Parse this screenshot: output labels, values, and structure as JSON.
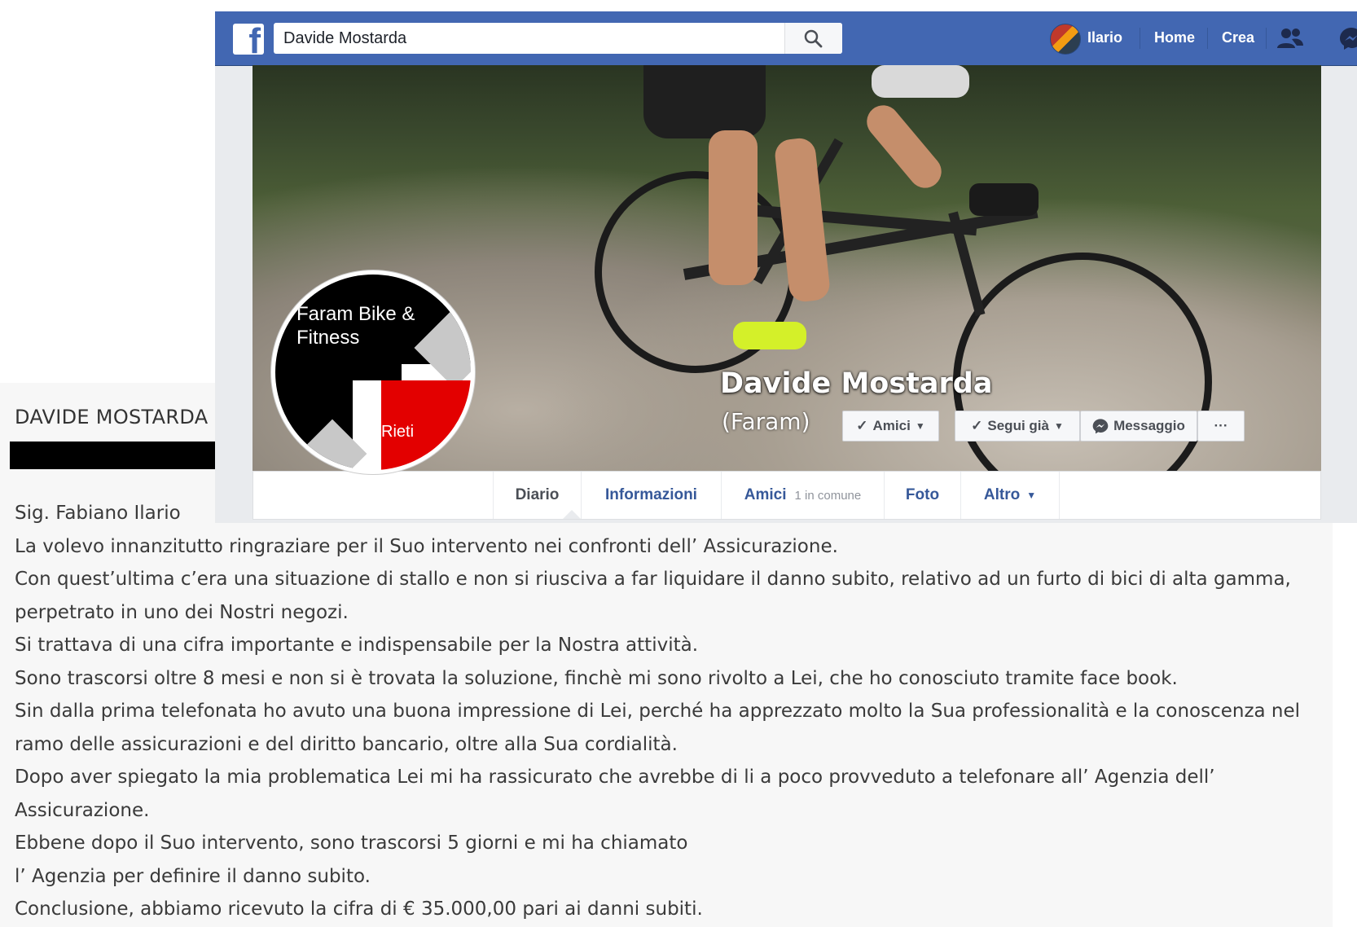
{
  "facebook": {
    "search": {
      "value": "Davide Mostarda"
    },
    "nav": {
      "user": "Ilario",
      "home": "Home",
      "create": "Crea"
    },
    "profile": {
      "name": "Davide Mostarda",
      "alternate_name": "(Faram)"
    },
    "avatar": {
      "line1": "Faram Bike &",
      "line2": "Fitness",
      "line3": "Rieti"
    },
    "buttons": {
      "friends": "Amici",
      "following": "Segui già",
      "message": "Messaggio",
      "more": "···"
    },
    "tabs": {
      "diario": "Diario",
      "informazioni": "Informazioni",
      "amici": "Amici",
      "amici_mutual": "1 in comune",
      "foto": "Foto",
      "altro": "Altro"
    }
  },
  "letter": {
    "sender": "DAVIDE MOSTARDA",
    "lines": [
      "Sig. Fabiano Ilario",
      "La volevo innanzitutto ringraziare per il Suo intervento nei confronti dell’ Assicurazione.",
      "Con quest’ultima c’era una situazione di stallo e non si riusciva a far liquidare il danno subito, relativo ad un furto di bici di alta gamma,",
      "perpetrato in uno dei Nostri negozi.",
      "Si trattava di una cifra importante e indispensabile per la Nostra attività.",
      "Sono trascorsi oltre 8 mesi e non si è trovata la soluzione, finchè mi sono rivolto a Lei, che ho conosciuto tramite face book.",
      "Sin dalla prima telefonata ho avuto una buona impressione di Lei, perché ha apprezzato molto la Sua professionalità e la conoscenza nel",
      "ramo delle assicurazioni e del diritto bancario, oltre alla Sua cordialità.",
      "Dopo aver spiegato la mia problematica Lei mi ha rassicurato che avrebbe di li a poco provveduto a telefonare all’ Agenzia dell’",
      "Assicurazione.",
      "Ebbene dopo il Suo intervento, sono trascorsi 5 giorni e mi ha chiamato",
      "l’ Agenzia per definire il danno subito.",
      "Conclusione, abbiamo ricevuto la cifra di € 35.000,00 pari ai danni subiti."
    ]
  },
  "colors": {
    "fb_blue": "#4267b2",
    "link_blue": "#365899",
    "avatar_red": "#e30000"
  }
}
